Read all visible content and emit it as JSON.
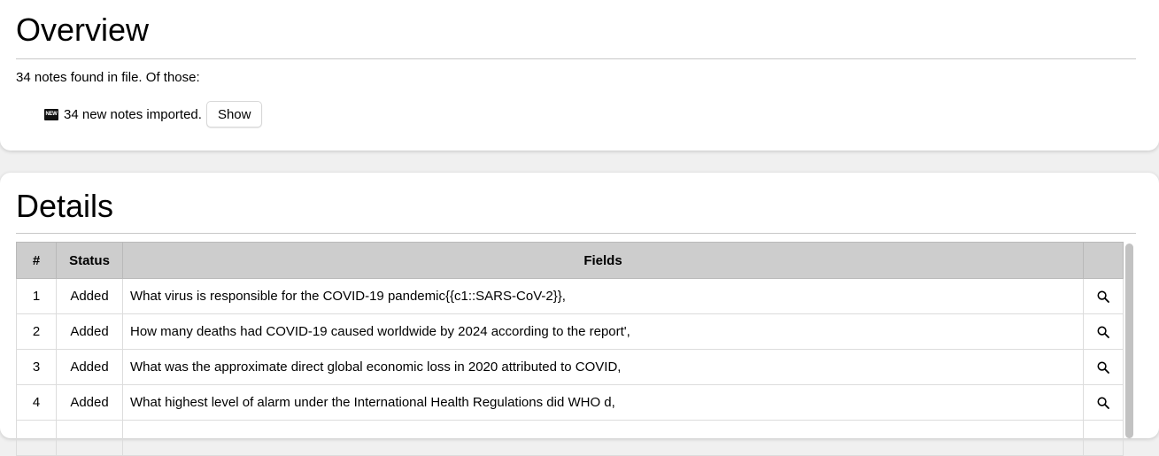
{
  "overview": {
    "title": "Overview",
    "summary": "34 notes found in file. Of those:",
    "badge_text": "NEW",
    "imported_text": "34 new notes imported.",
    "show_label": "Show"
  },
  "details": {
    "title": "Details",
    "columns": [
      "#",
      "Status",
      "Fields",
      ""
    ],
    "rows": [
      {
        "num": "1",
        "status": "Added",
        "fields": "What virus is responsible for the COVID-19 pandemic{{c1::SARS-CoV-2}},"
      },
      {
        "num": "2",
        "status": "Added",
        "fields": "How many deaths had COVID-19 caused worldwide by 2024 according to the report',"
      },
      {
        "num": "3",
        "status": "Added",
        "fields": "What was the approximate direct global economic loss in 2020 attributed to COVID,"
      },
      {
        "num": "4",
        "status": "Added",
        "fields": "What highest level of alarm under the International Health Regulations did WHO d,"
      },
      {
        "num": "",
        "status": "",
        "fields": ""
      }
    ],
    "row_action_icon": "magnifier-icon"
  }
}
